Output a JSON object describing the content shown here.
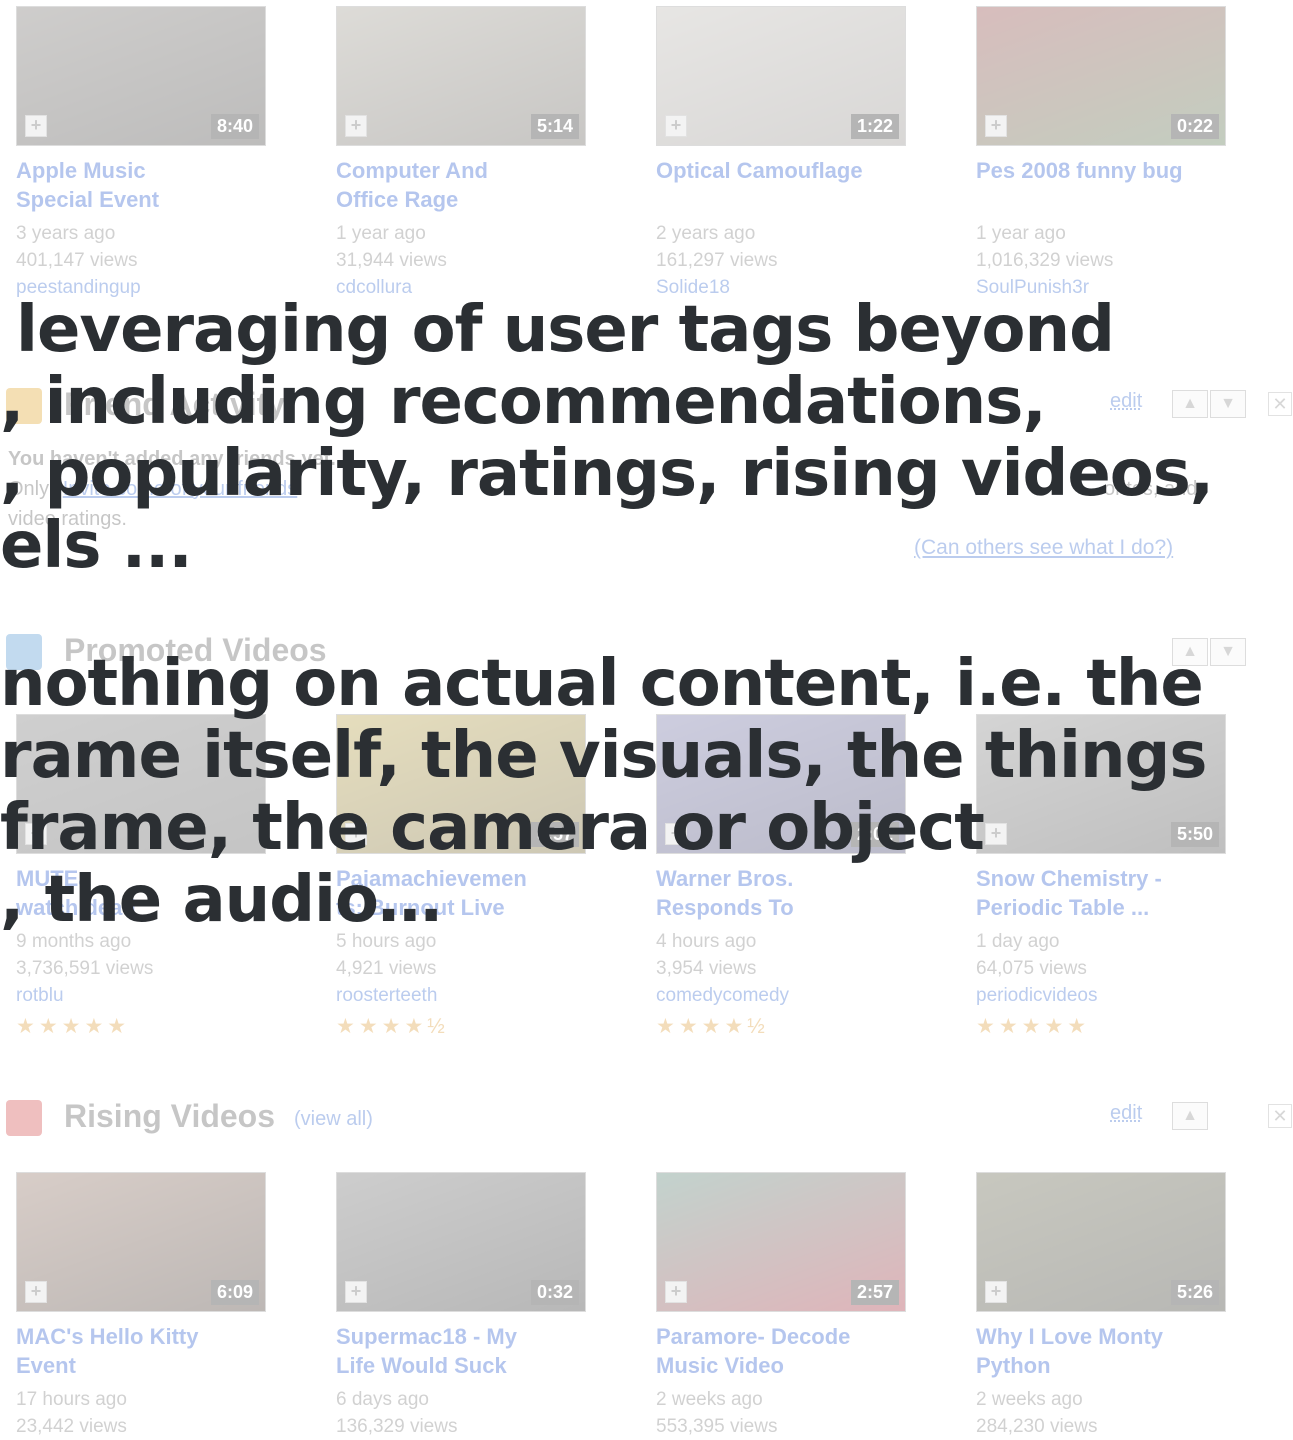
{
  "top_videos": [
    {
      "duration": "8:40",
      "title_lines": [
        "Apple Music",
        "Special Event"
      ],
      "age": "3 years ago",
      "views": "401,147 views",
      "author": "peestandingup",
      "thumb_colors": [
        "#6e6a66",
        "#3a3836"
      ]
    },
    {
      "duration": "5:14",
      "title_lines": [
        "Computer And",
        "Office Rage"
      ],
      "age": "1 year ago",
      "views": "31,944 views",
      "author": "cdcollura",
      "thumb_colors": [
        "#9a9589",
        "#5a564f"
      ]
    },
    {
      "duration": "1:22",
      "title_lines": [
        "Optical Camouflage",
        ""
      ],
      "age": "2 years ago",
      "views": "161,297 views",
      "author": "Solide18",
      "thumb_colors": [
        "#b8b4ae",
        "#8c8884"
      ]
    },
    {
      "duration": "0:22",
      "title_lines": [
        "Pes 2008 funny bug",
        ""
      ],
      "age": "1 year ago",
      "views": "1,016,329 views",
      "author": "SoulPunish3r",
      "thumb_colors": [
        "#8a3a3a",
        "#4b6a40"
      ]
    }
  ],
  "friend_activity": {
    "title": "Friend Activity",
    "edit": "edit",
    "line1": "You haven't added any friends yet.",
    "line2_start": "Only",
    "line2_link": "Invite some of your friends",
    "line2_end": "orites, and",
    "line3": "video ratings.",
    "privacy_link": "(Can others see what I do?)"
  },
  "promoted": {
    "title": "Promoted Videos",
    "videos": [
      {
        "duration": "",
        "title_lines": [
          "MUTEa",
          "watch dead"
        ],
        "age": "9 months ago",
        "views": "3,736,591 views",
        "author": "rotblu",
        "stars": "★★★★★",
        "thumb_colors": [
          "#707070",
          "#505050"
        ]
      },
      {
        "duration": "5:57",
        "title_lines": [
          "Pajamachievemen",
          "ts: Burnout Live"
        ],
        "age": "5 hours ago",
        "views": "4,921 views",
        "author": "roosterteeth",
        "stars": "★★★★½",
        "thumb_colors": [
          "#b39b3a",
          "#6a5a20"
        ]
      },
      {
        "duration": "2:02",
        "title_lines": [
          "Warner Bros.",
          "Responds To"
        ],
        "age": "4 hours ago",
        "views": "3,954 views",
        "author": "comedycomedy",
        "stars": "★★★★½",
        "thumb_colors": [
          "#6a6aa0",
          "#343460"
        ]
      },
      {
        "duration": "5:50",
        "title_lines": [
          "Snow Chemistry -",
          "Periodic Table ..."
        ],
        "age": "1 day ago",
        "views": "64,075 views",
        "author": "periodicvideos",
        "stars": "★★★★★",
        "thumb_colors": [
          "#808080",
          "#404040"
        ]
      }
    ]
  },
  "rising": {
    "title": "Rising Videos",
    "view_all": "(view all)",
    "edit": "edit",
    "videos": [
      {
        "duration": "6:09",
        "title_lines": [
          "MAC's Hello Kitty",
          "Event"
        ],
        "age": "17 hours ago",
        "views": "23,442 views",
        "thumb_colors": [
          "#8a6a5a",
          "#3a2a22"
        ]
      },
      {
        "duration": "0:32",
        "title_lines": [
          "Supermac18 - My",
          "Life Would Suck"
        ],
        "age": "6 days ago",
        "views": "136,329 views",
        "thumb_colors": [
          "#6a6a6a",
          "#2a2a2a"
        ]
      },
      {
        "duration": "2:57",
        "title_lines": [
          "Paramore- Decode",
          "Music Video"
        ],
        "age": "2 weeks ago",
        "views": "553,395 views",
        "thumb_colors": [
          "#4a7a6a",
          "#a02030"
        ]
      },
      {
        "duration": "5:26",
        "title_lines": [
          "Why I Love Monty",
          "Python"
        ],
        "age": "2 weeks ago",
        "views": "284,230 views",
        "thumb_colors": [
          "#5a5a40",
          "#2a2a20"
        ]
      }
    ]
  },
  "overlay_text": [
    "leveraging of user tags beyond",
    ", including recommendations,",
    ", popularity, ratings, rising videos,",
    "els ...",
    "nothing on actual content, i.e. the",
    "rame itself, the visuals, the things",
    "frame, the camera or object",
    ", the audio…"
  ],
  "colors": {
    "link": "#2255cc",
    "overlay_text": "#2b2f33",
    "stars": "#dd9933",
    "rising_icon": "#d04040",
    "promoted_icon": "#4a90d0",
    "friend_icon": "#e0a020"
  }
}
